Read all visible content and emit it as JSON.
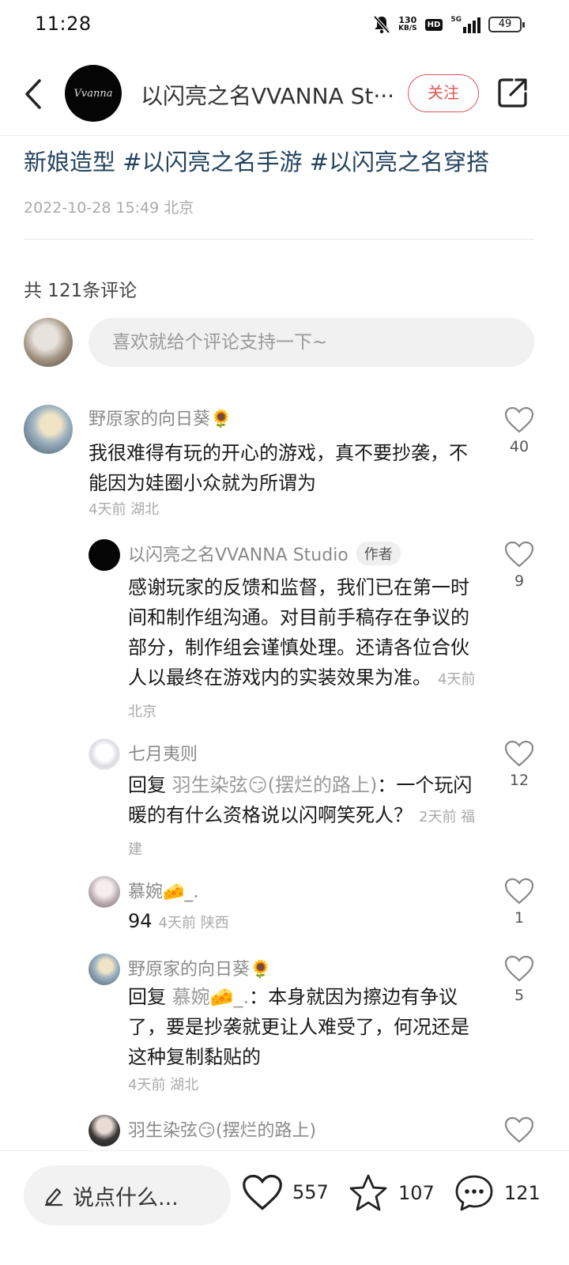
{
  "status_bar": {
    "time": "11:28",
    "speed_value": "130",
    "speed_unit": "KB/S",
    "hd": "HD",
    "network": "5G",
    "battery": "49"
  },
  "header": {
    "title": "以闪亮之名VVANNA St···",
    "follow_label": "关注",
    "avatar_logo_text": "Vvanna"
  },
  "post": {
    "tags": "新娘造型 #以闪亮之名手游 #以闪亮之名穿搭",
    "time_location": "2022-10-28 15:49 北京"
  },
  "comments_header": {
    "count_text": "共 121条评论",
    "input_placeholder": "喜欢就给个评论支持一下~"
  },
  "comments": [
    {
      "name": "野原家的向日葵🌻",
      "text": "我很难得有玩的开心的游戏，真不要抄袭，不能因为娃圈小众就为所谓为",
      "meta": "4天前  湖北",
      "likes": "40"
    },
    {
      "name": "以闪亮之名VVANNA Studio",
      "badge": "作者",
      "text": "感谢玩家的反馈和监督，我们已在第一时间和制作组沟通。对目前手稿存在争议的部分，制作组会谨慎处理。还请各位合伙人以最终在游戏内的实装效果为准。",
      "meta": "4天前  北京",
      "likes": "9"
    },
    {
      "name": "七月夷则",
      "reply_prefix": "回复",
      "reply_to": "羽生染弦😏(摆烂的路上)",
      "text": "：一个玩闪暖的有什么资格说以闪啊笑死人？",
      "meta": "2天前  福建",
      "likes": "12"
    },
    {
      "name": "慕婉🧀_.",
      "text": "94",
      "meta": "4天前  陕西",
      "likes": "1"
    },
    {
      "name": "野原家的向日葵🌻",
      "reply_prefix": "回复",
      "reply_to": "慕婉🧀_.",
      "text": "：本身就因为擦边有争议了，要是抄袭就更让人难受了，何况还是这种复制黏贴的",
      "meta": "4天前  湖北",
      "likes": "5"
    },
    {
      "name": "羽生染弦😏(摆烂的路上)"
    }
  ],
  "bottom_bar": {
    "input_label": "说点什么...",
    "likes": "557",
    "favorites": "107",
    "comments": "121"
  },
  "colors": {
    "follow": "#e05454",
    "tag": "#24435f",
    "muted": "#aaaaaa"
  },
  "icons": [
    "back-icon",
    "share-icon",
    "heart-icon",
    "star-icon",
    "comment-icon",
    "pencil-icon"
  ]
}
